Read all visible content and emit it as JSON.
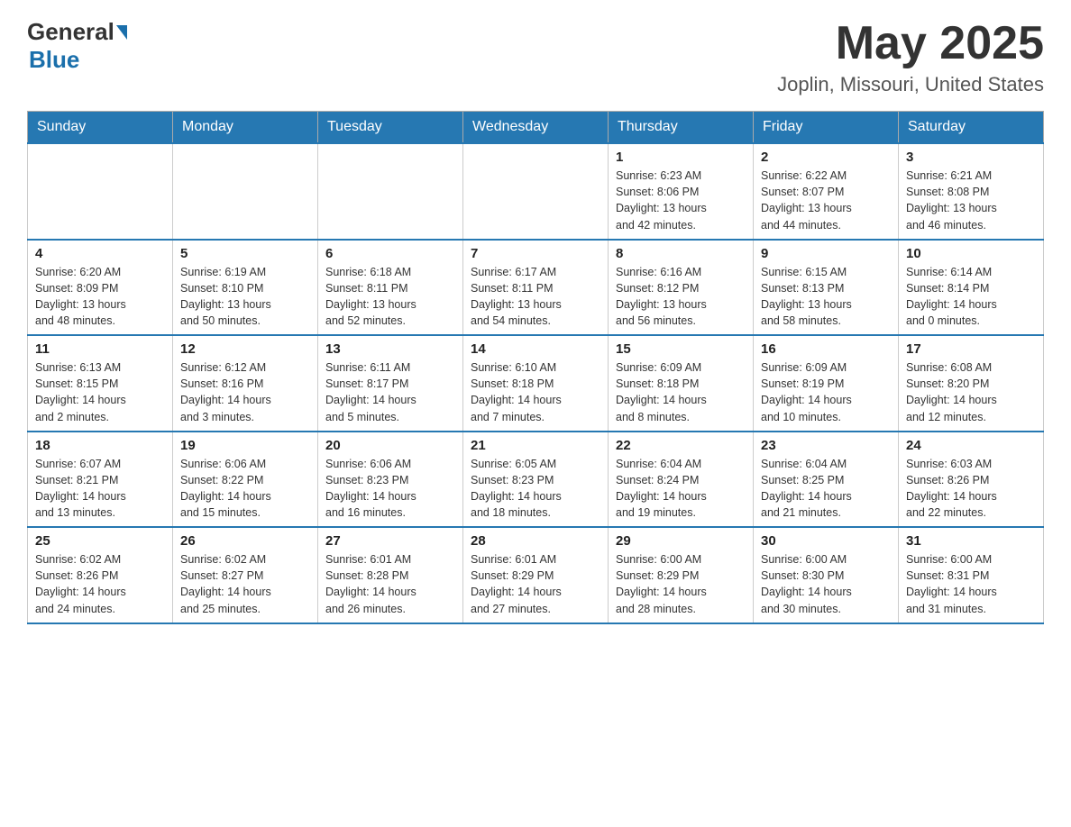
{
  "header": {
    "logo_general": "General",
    "logo_blue": "Blue",
    "month_year": "May 2025",
    "location": "Joplin, Missouri, United States"
  },
  "days_of_week": [
    "Sunday",
    "Monday",
    "Tuesday",
    "Wednesday",
    "Thursday",
    "Friday",
    "Saturday"
  ],
  "weeks": [
    [
      {
        "day": "",
        "info": ""
      },
      {
        "day": "",
        "info": ""
      },
      {
        "day": "",
        "info": ""
      },
      {
        "day": "",
        "info": ""
      },
      {
        "day": "1",
        "info": "Sunrise: 6:23 AM\nSunset: 8:06 PM\nDaylight: 13 hours\nand 42 minutes."
      },
      {
        "day": "2",
        "info": "Sunrise: 6:22 AM\nSunset: 8:07 PM\nDaylight: 13 hours\nand 44 minutes."
      },
      {
        "day": "3",
        "info": "Sunrise: 6:21 AM\nSunset: 8:08 PM\nDaylight: 13 hours\nand 46 minutes."
      }
    ],
    [
      {
        "day": "4",
        "info": "Sunrise: 6:20 AM\nSunset: 8:09 PM\nDaylight: 13 hours\nand 48 minutes."
      },
      {
        "day": "5",
        "info": "Sunrise: 6:19 AM\nSunset: 8:10 PM\nDaylight: 13 hours\nand 50 minutes."
      },
      {
        "day": "6",
        "info": "Sunrise: 6:18 AM\nSunset: 8:11 PM\nDaylight: 13 hours\nand 52 minutes."
      },
      {
        "day": "7",
        "info": "Sunrise: 6:17 AM\nSunset: 8:11 PM\nDaylight: 13 hours\nand 54 minutes."
      },
      {
        "day": "8",
        "info": "Sunrise: 6:16 AM\nSunset: 8:12 PM\nDaylight: 13 hours\nand 56 minutes."
      },
      {
        "day": "9",
        "info": "Sunrise: 6:15 AM\nSunset: 8:13 PM\nDaylight: 13 hours\nand 58 minutes."
      },
      {
        "day": "10",
        "info": "Sunrise: 6:14 AM\nSunset: 8:14 PM\nDaylight: 14 hours\nand 0 minutes."
      }
    ],
    [
      {
        "day": "11",
        "info": "Sunrise: 6:13 AM\nSunset: 8:15 PM\nDaylight: 14 hours\nand 2 minutes."
      },
      {
        "day": "12",
        "info": "Sunrise: 6:12 AM\nSunset: 8:16 PM\nDaylight: 14 hours\nand 3 minutes."
      },
      {
        "day": "13",
        "info": "Sunrise: 6:11 AM\nSunset: 8:17 PM\nDaylight: 14 hours\nand 5 minutes."
      },
      {
        "day": "14",
        "info": "Sunrise: 6:10 AM\nSunset: 8:18 PM\nDaylight: 14 hours\nand 7 minutes."
      },
      {
        "day": "15",
        "info": "Sunrise: 6:09 AM\nSunset: 8:18 PM\nDaylight: 14 hours\nand 8 minutes."
      },
      {
        "day": "16",
        "info": "Sunrise: 6:09 AM\nSunset: 8:19 PM\nDaylight: 14 hours\nand 10 minutes."
      },
      {
        "day": "17",
        "info": "Sunrise: 6:08 AM\nSunset: 8:20 PM\nDaylight: 14 hours\nand 12 minutes."
      }
    ],
    [
      {
        "day": "18",
        "info": "Sunrise: 6:07 AM\nSunset: 8:21 PM\nDaylight: 14 hours\nand 13 minutes."
      },
      {
        "day": "19",
        "info": "Sunrise: 6:06 AM\nSunset: 8:22 PM\nDaylight: 14 hours\nand 15 minutes."
      },
      {
        "day": "20",
        "info": "Sunrise: 6:06 AM\nSunset: 8:23 PM\nDaylight: 14 hours\nand 16 minutes."
      },
      {
        "day": "21",
        "info": "Sunrise: 6:05 AM\nSunset: 8:23 PM\nDaylight: 14 hours\nand 18 minutes."
      },
      {
        "day": "22",
        "info": "Sunrise: 6:04 AM\nSunset: 8:24 PM\nDaylight: 14 hours\nand 19 minutes."
      },
      {
        "day": "23",
        "info": "Sunrise: 6:04 AM\nSunset: 8:25 PM\nDaylight: 14 hours\nand 21 minutes."
      },
      {
        "day": "24",
        "info": "Sunrise: 6:03 AM\nSunset: 8:26 PM\nDaylight: 14 hours\nand 22 minutes."
      }
    ],
    [
      {
        "day": "25",
        "info": "Sunrise: 6:02 AM\nSunset: 8:26 PM\nDaylight: 14 hours\nand 24 minutes."
      },
      {
        "day": "26",
        "info": "Sunrise: 6:02 AM\nSunset: 8:27 PM\nDaylight: 14 hours\nand 25 minutes."
      },
      {
        "day": "27",
        "info": "Sunrise: 6:01 AM\nSunset: 8:28 PM\nDaylight: 14 hours\nand 26 minutes."
      },
      {
        "day": "28",
        "info": "Sunrise: 6:01 AM\nSunset: 8:29 PM\nDaylight: 14 hours\nand 27 minutes."
      },
      {
        "day": "29",
        "info": "Sunrise: 6:00 AM\nSunset: 8:29 PM\nDaylight: 14 hours\nand 28 minutes."
      },
      {
        "day": "30",
        "info": "Sunrise: 6:00 AM\nSunset: 8:30 PM\nDaylight: 14 hours\nand 30 minutes."
      },
      {
        "day": "31",
        "info": "Sunrise: 6:00 AM\nSunset: 8:31 PM\nDaylight: 14 hours\nand 31 minutes."
      }
    ]
  ]
}
